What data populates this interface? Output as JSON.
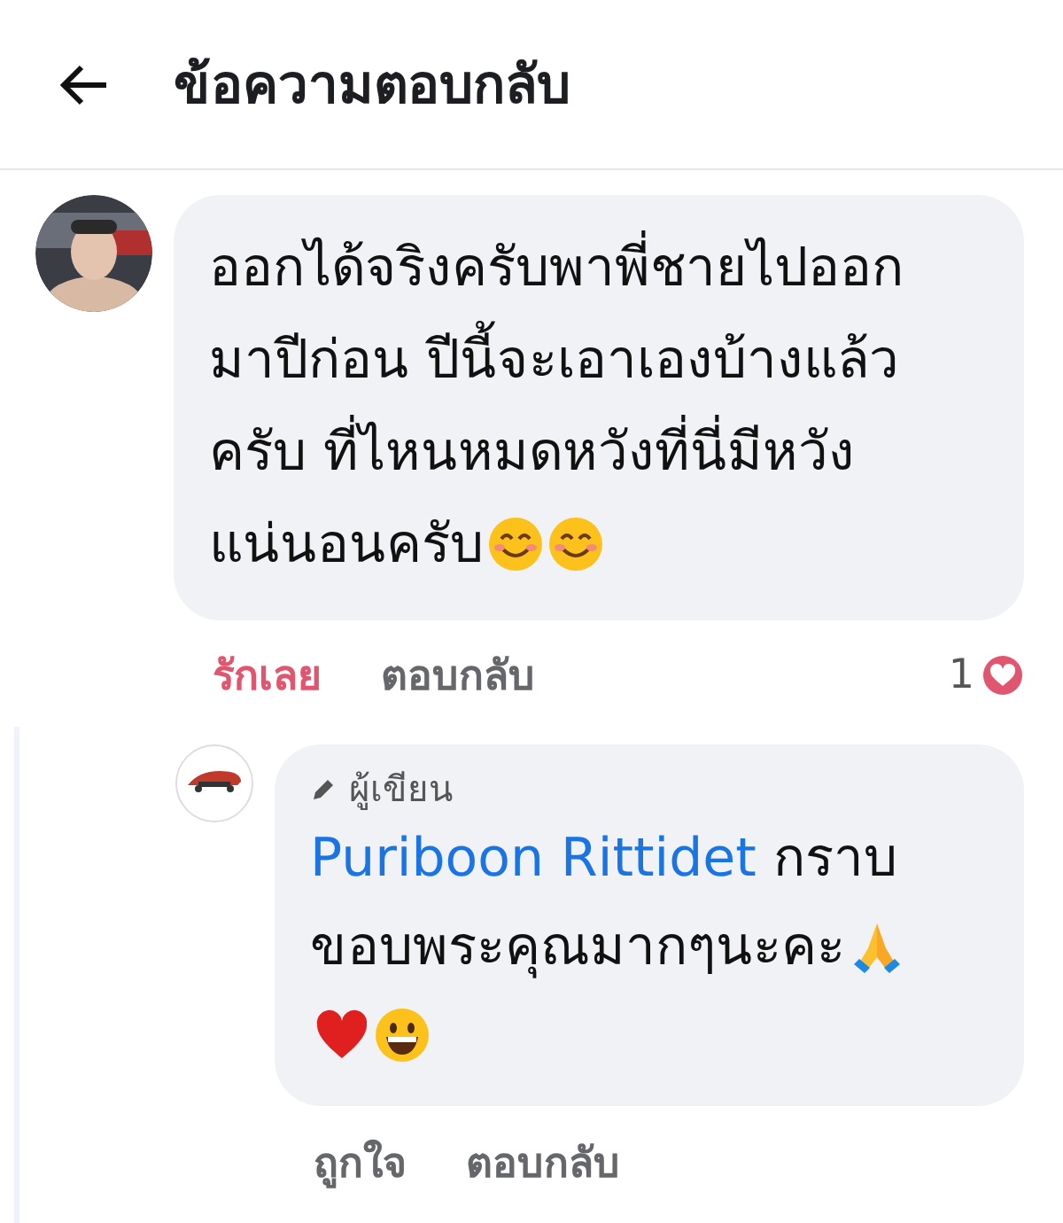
{
  "header": {
    "title": "ข้อความตอบกลับ"
  },
  "comment": {
    "text": "ออกได้จริงครับพาพี่ชายไปออกมาปีก่อน ปีนี้จะเอาเองบ้างแล้วครับ ที่ไหนหมดหวังที่นี่มีหวังแน่นอนครับ",
    "emojis": [
      {
        "kind": "smile"
      },
      {
        "kind": "smile"
      }
    ],
    "actions": [
      {
        "label": "รักเลย",
        "selected": true
      },
      {
        "label": "ตอบกลับ",
        "selected": false
      }
    ],
    "reaction_count": "1"
  },
  "reply": {
    "badge": "ผู้เขียน",
    "mention": "Puriboon Rittidet",
    "text": " กราบขอบพระคุณมากๆนะคะ",
    "emojis": [
      {
        "kind": "pray"
      },
      {
        "kind": "heart"
      },
      {
        "kind": "grin"
      }
    ],
    "actions": [
      {
        "label": "ถูกใจ",
        "selected": false
      },
      {
        "label": "ตอบกลับ",
        "selected": false
      }
    ]
  }
}
